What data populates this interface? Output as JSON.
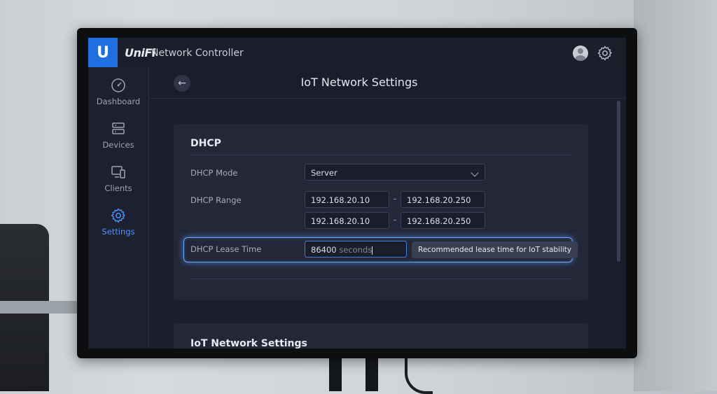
{
  "app": {
    "logo_letter": "U",
    "brand": "UniFi",
    "title": "Network Controller",
    "accent_color": "#1f6fe0"
  },
  "sidebar": {
    "items": [
      {
        "label": "Dashboard",
        "icon": "speedometer-icon",
        "active": false
      },
      {
        "label": "Devices",
        "icon": "device-stack-icon",
        "active": false
      },
      {
        "label": "Clients",
        "icon": "monitor-phone-icon",
        "active": false
      },
      {
        "label": "Settings",
        "icon": "gear-icon",
        "active": true
      }
    ]
  },
  "header": {
    "back_icon": "arrow-left-icon",
    "title": "IoT Network Settings"
  },
  "dhcp": {
    "section_title": "DHCP",
    "mode": {
      "label": "DHCP Mode",
      "value": "Server"
    },
    "range": {
      "label": "DHCP Range",
      "rows": [
        {
          "start": "192.168.20.10",
          "end": "192.168.20.250"
        },
        {
          "start": "192.168.20.10",
          "end": "192.168.20.250"
        }
      ],
      "separator": "-"
    },
    "lease": {
      "label": "DHCP Lease Time",
      "value": "86400",
      "unit": "seconds",
      "tooltip": "Recommended lease time for IoT stability"
    }
  },
  "section2": {
    "title": "IoT Network Settings"
  }
}
